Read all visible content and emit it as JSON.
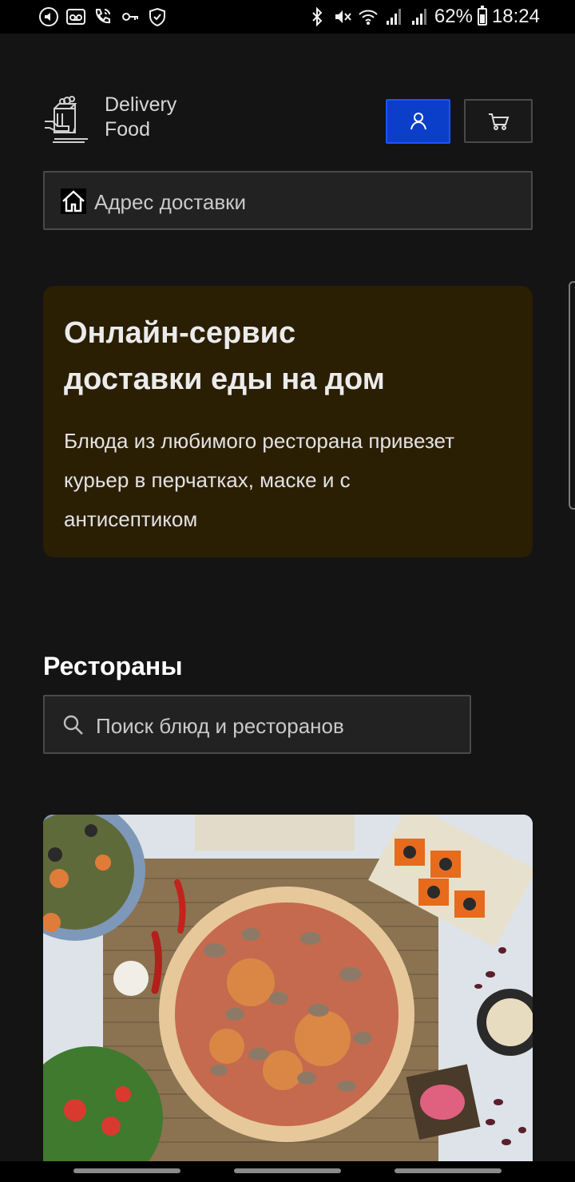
{
  "status_bar": {
    "battery": "62%",
    "time": "18:24",
    "left_icons": [
      "volume-icon",
      "voicemail-icon",
      "wifi-call-icon",
      "key-icon",
      "shield-icon"
    ],
    "right_icons": [
      "bluetooth-icon",
      "mute-icon",
      "wifi-icon",
      "signal-icon",
      "signal-icon",
      "battery-icon"
    ]
  },
  "header": {
    "logo": {
      "line1": "Delivery",
      "line2": "Food"
    },
    "user_button_icon": "user-icon",
    "cart_button_icon": "cart-icon"
  },
  "address": {
    "placeholder": "Адрес доставки",
    "icon": "home-icon"
  },
  "promo": {
    "title_line1": "Онлайн-сервис",
    "title_line2": "доставки еды на дом",
    "text_line1": "Блюда из любимого ресторана привезет",
    "text_line2": "курьер в перчатках, маске и с",
    "text_line3": "антисептиком"
  },
  "restaurants": {
    "title": "Рестораны",
    "search_placeholder": "Поиск блюд и ресторанов",
    "search_icon": "search-icon"
  },
  "colors": {
    "background": "#141414",
    "accent": "#0b3fc9",
    "promo_bg": "#2a1e03"
  }
}
